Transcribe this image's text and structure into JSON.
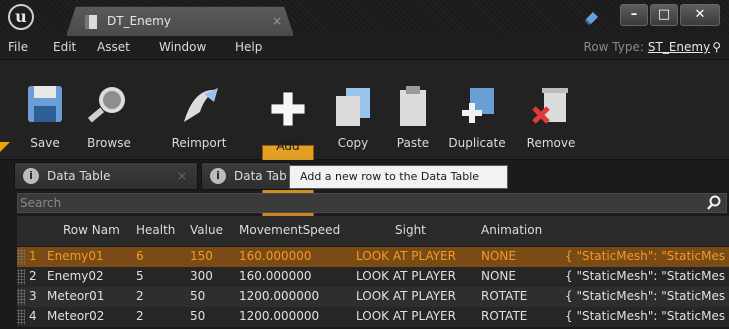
{
  "window": {
    "tab_title": "DT_Enemy",
    "tab_close": "×",
    "min": "–",
    "max": "□",
    "close": "✕",
    "logo": "u"
  },
  "menu": {
    "items": [
      "File",
      "Edit",
      "Asset",
      "Window",
      "Help"
    ],
    "row_type_label": "Row Type:",
    "row_type_value": "ST_Enemy"
  },
  "toolbar": {
    "items": [
      {
        "label": "Save",
        "icon": "save-icon"
      },
      {
        "label": "Browse",
        "icon": "browse-icon"
      },
      {
        "label": "Reimport",
        "icon": "reimport-icon"
      },
      {
        "label": "Add",
        "icon": "add-icon",
        "active": true
      },
      {
        "label": "Copy",
        "icon": "copy-icon"
      },
      {
        "label": "Paste",
        "icon": "paste-icon"
      },
      {
        "label": "Duplicate",
        "icon": "duplicate-icon"
      },
      {
        "label": "Remove",
        "icon": "remove-icon"
      }
    ],
    "accent": "#e5a226"
  },
  "tabs": [
    {
      "label": "Data Table",
      "icon": "info-icon"
    },
    {
      "label": "Data Tab",
      "icon": "info-icon"
    }
  ],
  "tooltip": "Add a new row to the Data Table",
  "search": {
    "placeholder": "Search",
    "value": ""
  },
  "table": {
    "columns": [
      "Row Name",
      "Health",
      "Value",
      "MovementSpeed",
      "Sight",
      "Animation",
      ""
    ],
    "header_display": [
      "Row Nam",
      "Health",
      "Value",
      "MovementSpeed",
      "Sight",
      "Animation",
      ""
    ],
    "rows": [
      {
        "index": "1",
        "cells": [
          "Enemy01",
          "6",
          "150",
          "160.000000",
          "LOOK AT PLAYER",
          "NONE",
          "{ \"StaticMesh\": \"StaticMes"
        ],
        "selected": true
      },
      {
        "index": "2",
        "cells": [
          "Enemy02",
          "5",
          "300",
          "160.000000",
          "LOOK AT PLAYER",
          "NONE",
          "{ \"StaticMesh\": \"StaticMes"
        ],
        "selected": false
      },
      {
        "index": "3",
        "cells": [
          "Meteor01",
          "2",
          "50",
          "1200.000000",
          "LOOK AT PLAYER",
          "ROTATE",
          "{ \"StaticMesh\": \"StaticMes"
        ],
        "selected": false
      },
      {
        "index": "4",
        "cells": [
          "Meteor02",
          "2",
          "50",
          "1200.000000",
          "LOOK AT PLAYER",
          "ROTATE",
          "{ \"StaticMesh\": \"StaticMes"
        ],
        "selected": false
      }
    ],
    "selected_color": "#f39a28"
  }
}
